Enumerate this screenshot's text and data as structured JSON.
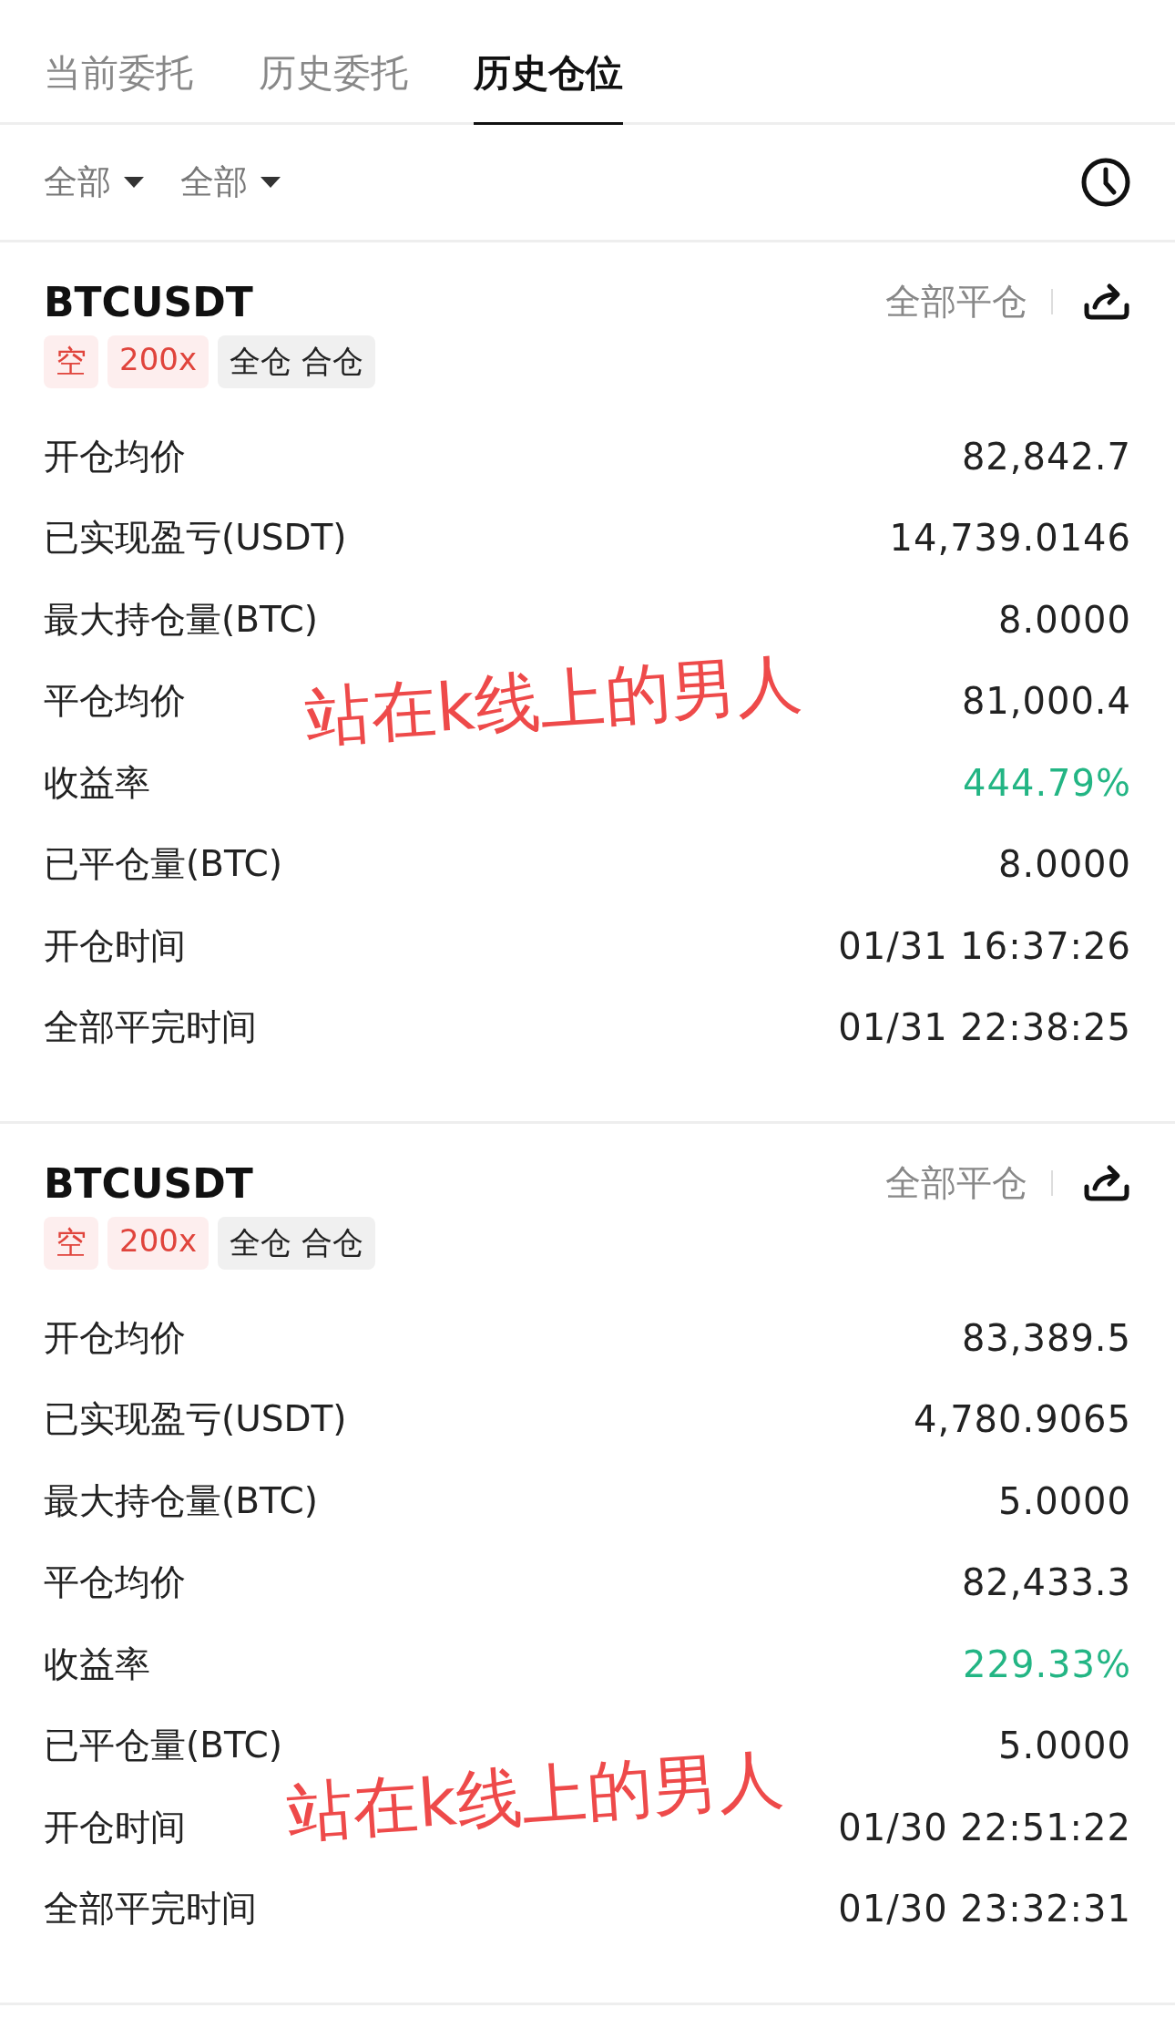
{
  "tabs": [
    {
      "label": "当前委托",
      "selected": false
    },
    {
      "label": "历史委托",
      "selected": false
    },
    {
      "label": "历史仓位",
      "selected": true
    }
  ],
  "filters": [
    "全部",
    "全部"
  ],
  "positions": [
    {
      "symbol": "BTCUSDT",
      "close_all": "全部平仓",
      "tags": [
        {
          "kind": "side",
          "label": "空"
        },
        {
          "kind": "leverage",
          "label": "200x"
        },
        {
          "kind": "mode",
          "label": "全仓 合仓"
        }
      ],
      "rows": [
        {
          "label": "开仓均价",
          "value": "82,842.7",
          "kind": "plain"
        },
        {
          "label": "已实现盈亏(USDT)",
          "value": "14,739.0146",
          "kind": "plain"
        },
        {
          "label": "最大持仓量(BTC)",
          "value": "8.0000",
          "kind": "plain"
        },
        {
          "label": "平仓均价",
          "value": "81,000.4",
          "kind": "plain"
        },
        {
          "label": "收益率",
          "value": "444.79%",
          "kind": "profit"
        },
        {
          "label": "已平仓量(BTC)",
          "value": "8.0000",
          "kind": "plain"
        },
        {
          "label": "开仓时间",
          "value": "01/31 16:37:26",
          "kind": "plain"
        },
        {
          "label": "全部平完时间",
          "value": "01/31 22:38:25",
          "kind": "plain"
        }
      ],
      "overlay_text": "站在k线上的男人"
    },
    {
      "symbol": "BTCUSDT",
      "close_all": "全部平仓",
      "tags": [
        {
          "kind": "side",
          "label": "空"
        },
        {
          "kind": "leverage",
          "label": "200x"
        },
        {
          "kind": "mode",
          "label": "全仓 合仓"
        }
      ],
      "rows": [
        {
          "label": "开仓均价",
          "value": "83,389.5",
          "kind": "plain"
        },
        {
          "label": "已实现盈亏(USDT)",
          "value": "4,780.9065",
          "kind": "plain"
        },
        {
          "label": "最大持仓量(BTC)",
          "value": "5.0000",
          "kind": "plain"
        },
        {
          "label": "平仓均价",
          "value": "82,433.3",
          "kind": "plain"
        },
        {
          "label": "收益率",
          "value": "229.33%",
          "kind": "profit"
        },
        {
          "label": "已平仓量(BTC)",
          "value": "5.0000",
          "kind": "plain"
        },
        {
          "label": "开仓时间",
          "value": "01/30 22:51:22",
          "kind": "plain"
        },
        {
          "label": "全部平完时间",
          "value": "01/30 23:32:31",
          "kind": "plain"
        }
      ],
      "overlay_text": "站在k线上的男人"
    }
  ]
}
